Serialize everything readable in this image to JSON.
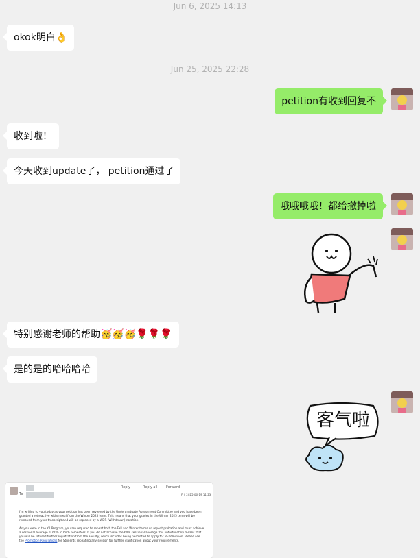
{
  "timestamps": [
    "Jun 6, 2025 14:13",
    "Jun 25, 2025 22:28"
  ],
  "messages": [
    {
      "side": "in",
      "text": "okok明白👌"
    },
    {
      "side": "out",
      "text": "petition有收到回复不"
    },
    {
      "side": "in",
      "text": "收到啦！"
    },
    {
      "side": "in",
      "text": "今天收到update了， petition通过了"
    },
    {
      "side": "out",
      "text": "哦哦哦哦！都给撤掉啦"
    },
    {
      "side": "in",
      "text": "特别感谢老师的帮助🥳🥳🥳🌹🌹🌹"
    },
    {
      "side": "in",
      "text": "是的是的哈哈哈哈"
    }
  ],
  "sticker2_text": "客气啦",
  "email": {
    "to_label": "To",
    "actions": [
      "Reply",
      "Reply all",
      "Forward"
    ],
    "date": "Fri, 2025-06-19 11:23",
    "para1": "I'm writing to you today as your petition has been reviewed by the Undergraduate Assessment Committee and you have been granted a retroactive withdrawal from the Winter 2025 term. This means that your grades in the Winter 2025 term will be removed from your transcript and will be replaced by a WDR (Withdrawn) notation.",
    "para2": "As you were in the Y1 Program, you are required to repeat both the Fall and Winter terms on repeat probation and must achieve a sessional average of 60% in both semesters. If you do not achieve the 60% sessional average this unfortunately means that you will be refused further registration from the Faculty, which includes being permitted to apply for re-admission. Please see the",
    "link": "Promotion Regulations",
    "para2_tail": "for Students repeating any session for further clarification about your requirements."
  }
}
